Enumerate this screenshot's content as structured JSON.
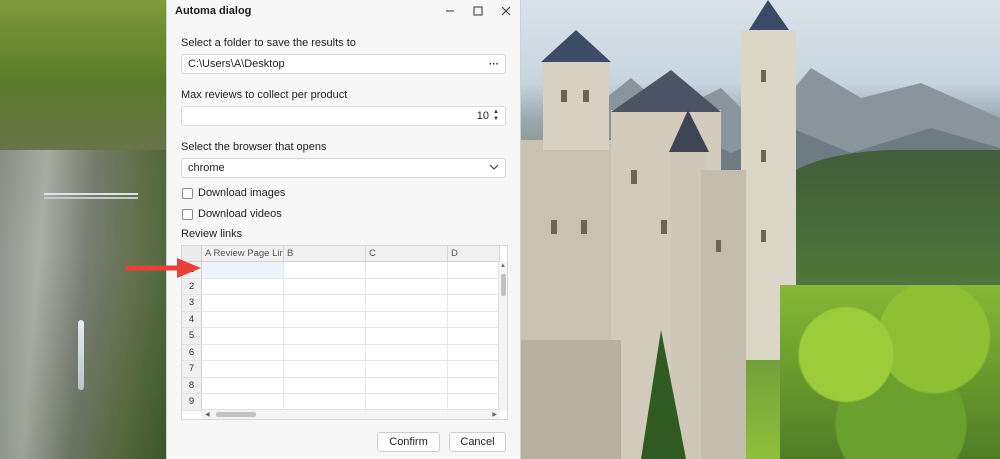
{
  "window": {
    "title": "Automa dialog",
    "controls": [
      "minimize-icon",
      "maximize-icon",
      "close-icon"
    ]
  },
  "folder": {
    "label": "Select a folder to save the results to",
    "value": "C:\\Users\\A\\Desktop",
    "browse_label": "···"
  },
  "max_reviews": {
    "label": "Max reviews to collect per product",
    "value": "10"
  },
  "browser": {
    "label": "Select the browser that opens",
    "selected": "chrome"
  },
  "options": {
    "download_images": "Download images",
    "download_videos": "Download videos"
  },
  "review_links": {
    "label": "Review links",
    "toolbar_icons": [
      "file-add-icon",
      "export-icon",
      "trash-icon"
    ]
  },
  "sheet": {
    "columns": [
      "A Review Page Link",
      "B",
      "C",
      "D"
    ],
    "rows": [
      "1",
      "2",
      "3",
      "4",
      "5",
      "6",
      "7",
      "8",
      "9"
    ]
  },
  "footer": {
    "confirm_label": "Confirm",
    "cancel_label": "Cancel"
  },
  "colors": {
    "annotation_arrow": "#e8413a",
    "selection_fill": "#eef4fc"
  }
}
